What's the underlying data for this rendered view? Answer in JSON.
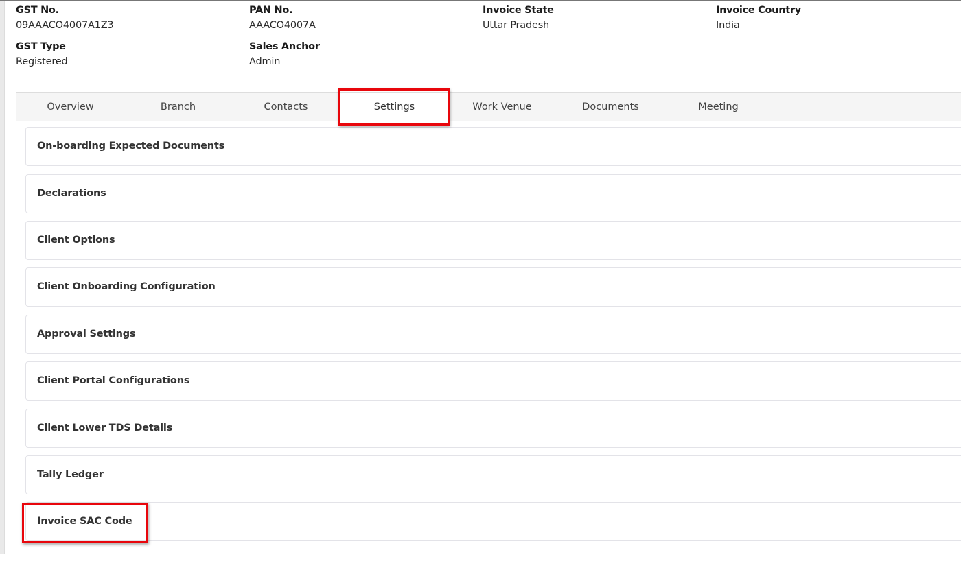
{
  "info": [
    {
      "label": "GST No.",
      "value": "09AAACO4007A1Z3"
    },
    {
      "label": "PAN No.",
      "value": "AAACO4007A"
    },
    {
      "label": "Invoice State",
      "value": "Uttar Pradesh"
    },
    {
      "label": "Invoice Country",
      "value": "India"
    },
    {
      "label": "GST Type",
      "value": "Registered"
    },
    {
      "label": "Sales Anchor",
      "value": "Admin"
    }
  ],
  "tabs": [
    "Overview",
    "Branch",
    "Contacts",
    "Settings",
    "Work Venue",
    "Documents",
    "Meeting"
  ],
  "active_tab": "Settings",
  "sections": [
    "On-boarding Expected Documents",
    "Declarations",
    "Client Options",
    "Client Onboarding Configuration",
    "Approval Settings",
    "Client Portal Configurations",
    "Client Lower TDS Details",
    "Tally Ledger",
    "Invoice SAC Code"
  ],
  "highlight_color": "#e8060c"
}
